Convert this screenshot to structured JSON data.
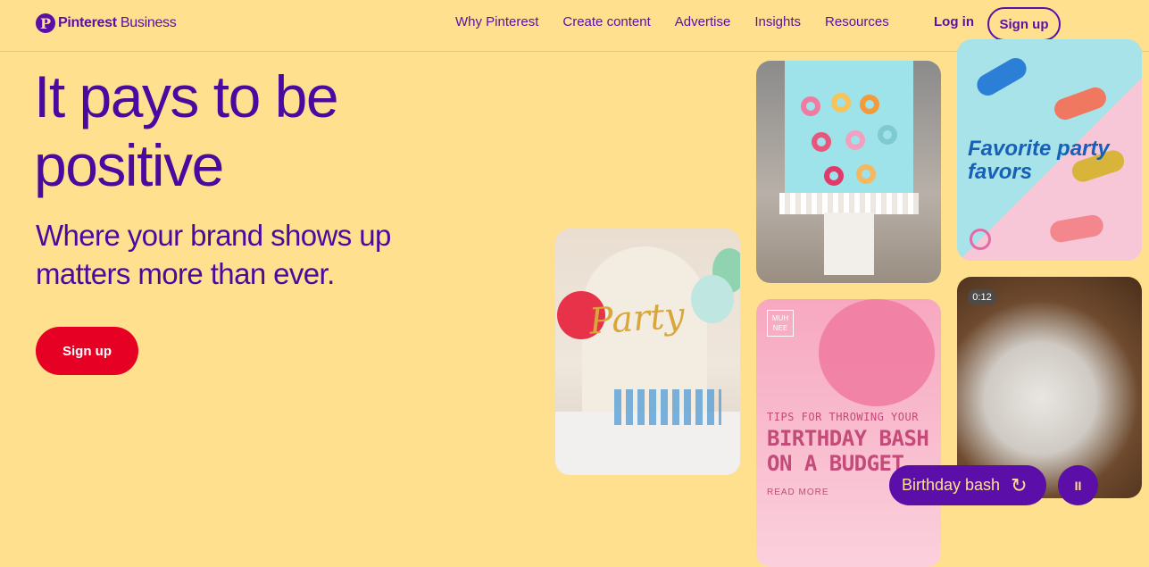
{
  "header": {
    "logo_mark": "P",
    "logo_brand": "Pinterest",
    "logo_suffix": " Business",
    "nav": [
      "Why Pinterest",
      "Create content",
      "Advertise",
      "Insights",
      "Resources"
    ],
    "login": "Log in",
    "signup": "Sign up"
  },
  "hero": {
    "headline": "It pays to be positive",
    "subhead": "Where your brand shows up matters more than ever.",
    "cta": "Sign up"
  },
  "tiles": {
    "party_text": "Party",
    "dino_text": "Favorite party favors",
    "budget_brand": "MUH NEE",
    "budget_small": "TIPS FOR THROWING YOUR",
    "budget_big": "BIRTHDAY BASH ON A BUDGET",
    "budget_more": "READ MORE",
    "video_time": "0:12"
  },
  "controls": {
    "topic": "Birthday bash",
    "refresh_icon": "↻",
    "pause_icon": "II"
  },
  "colors": {
    "background": "#ffe08f",
    "brand_purple": "#5b0ea8",
    "red": "#e60023"
  }
}
